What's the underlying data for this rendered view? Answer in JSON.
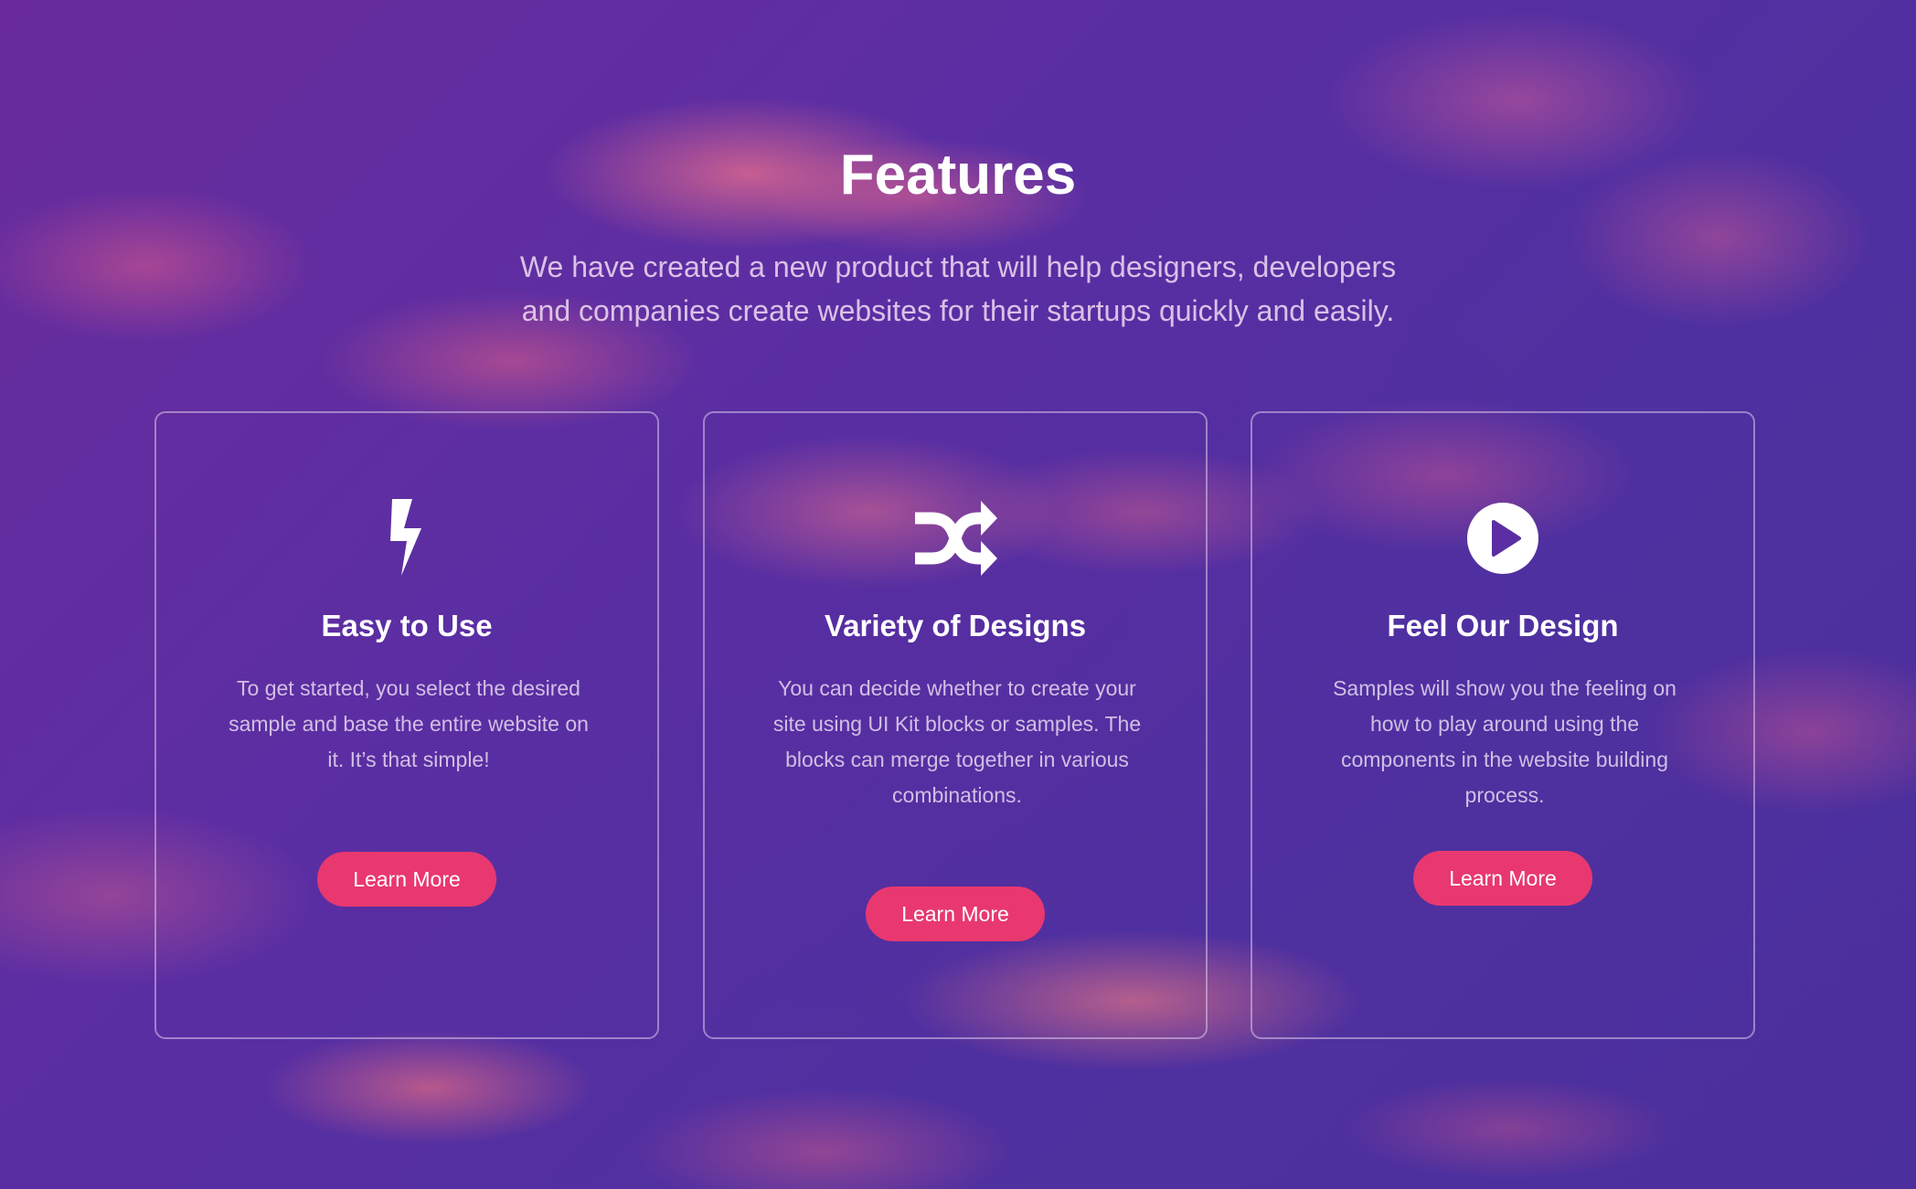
{
  "header": {
    "title": "Features",
    "subtitle_line1": "We have created a new product that will help designers, developers",
    "subtitle_line2": "and companies create websites for their startups quickly and easily."
  },
  "cards": [
    {
      "icon": "lightning-icon",
      "title": "Easy to Use",
      "text": "To get started, you select the desired sample and base the entire website on it. It’s that simple!",
      "button_label": "Learn More"
    },
    {
      "icon": "shuffle-icon",
      "title": "Variety of Designs",
      "text": "You can decide whether to create your site using UI Kit blocks or samples. The blocks can merge together in various combinations.",
      "button_label": "Learn More"
    },
    {
      "icon": "play-circle-icon",
      "title": "Feel Our Design",
      "text": "Samples will show you the feeling on how to play around using the components in the website building process.",
      "button_label": "Learn More"
    }
  ],
  "colors": {
    "accent": "#e8386f",
    "background": "#5b2ea3",
    "text": "#ffffff"
  }
}
